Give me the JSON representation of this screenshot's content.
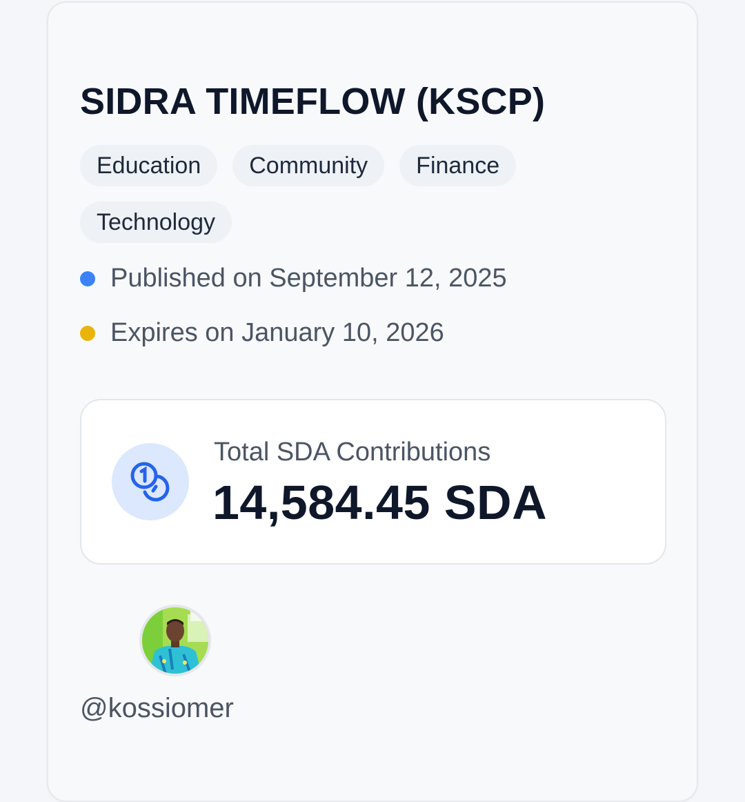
{
  "project": {
    "title": "SIDRA TIMEFLOW (KSCP)",
    "tags": [
      "Education",
      "Community",
      "Finance",
      "Technology"
    ]
  },
  "dates": {
    "published": "Published on September 12, 2025",
    "expires": "Expires on January 10, 2026"
  },
  "contributions": {
    "label": "Total SDA Contributions",
    "value": "14,584.45 SDA",
    "icon": "coins-icon"
  },
  "creator": {
    "username": "@kossiomer"
  },
  "colors": {
    "published_dot": "#3b82f6",
    "expires_dot": "#eab308",
    "icon_blue": "#2563eb",
    "icon_bg": "#dbe8fd",
    "title": "#0f172a",
    "muted": "#4b5563"
  }
}
